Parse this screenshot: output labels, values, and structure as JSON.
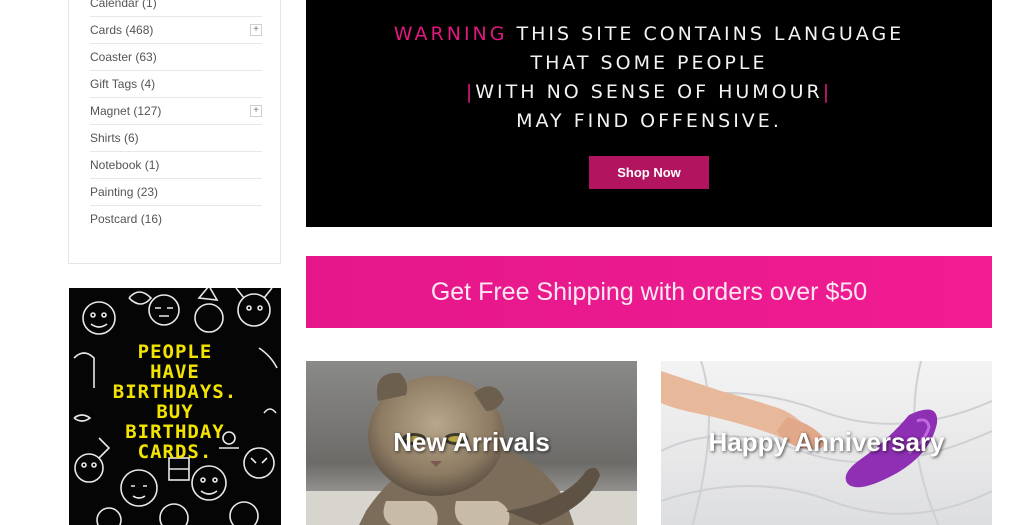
{
  "categories": [
    {
      "label": "Calendar (1)",
      "expandable": false
    },
    {
      "label": "Cards (468)",
      "expandable": true
    },
    {
      "label": "Coaster (63)",
      "expandable": false
    },
    {
      "label": "Gift Tags (4)",
      "expandable": false
    },
    {
      "label": "Magnet (127)",
      "expandable": true
    },
    {
      "label": "Shirts (6)",
      "expandable": false
    },
    {
      "label": "Notebook (1)",
      "expandable": false
    },
    {
      "label": "Painting (23)",
      "expandable": false
    },
    {
      "label": "Postcard (16)",
      "expandable": false
    }
  ],
  "expand_symbol": "+",
  "sidebar_banner": {
    "lines": [
      "PEOPLE",
      "HAVE",
      "BIRTHDAYS.",
      "BUY",
      "BIRTHDAY",
      "CARDS."
    ]
  },
  "hero": {
    "warning_word": "WARNING",
    "line1_rest": " THIS SITE CONTAINS LANGUAGE",
    "line2": "THAT SOME PEOPLE",
    "bar": "|",
    "line3": "WITH NO SENSE OF HUMOUR",
    "line4": "MAY FIND OFFENSIVE.",
    "button_label": "Shop Now"
  },
  "shipping_banner": "Get Free Shipping with orders over $50",
  "tiles": [
    {
      "label": "New Arrivals",
      "icon": "cat-photo"
    },
    {
      "label": "Happy Anniversary",
      "icon": "bedsheet-photo"
    }
  ],
  "colors": {
    "accent_pink": "#e2177f",
    "button": "#b3145f",
    "banner_yellow": "#f2e400"
  }
}
